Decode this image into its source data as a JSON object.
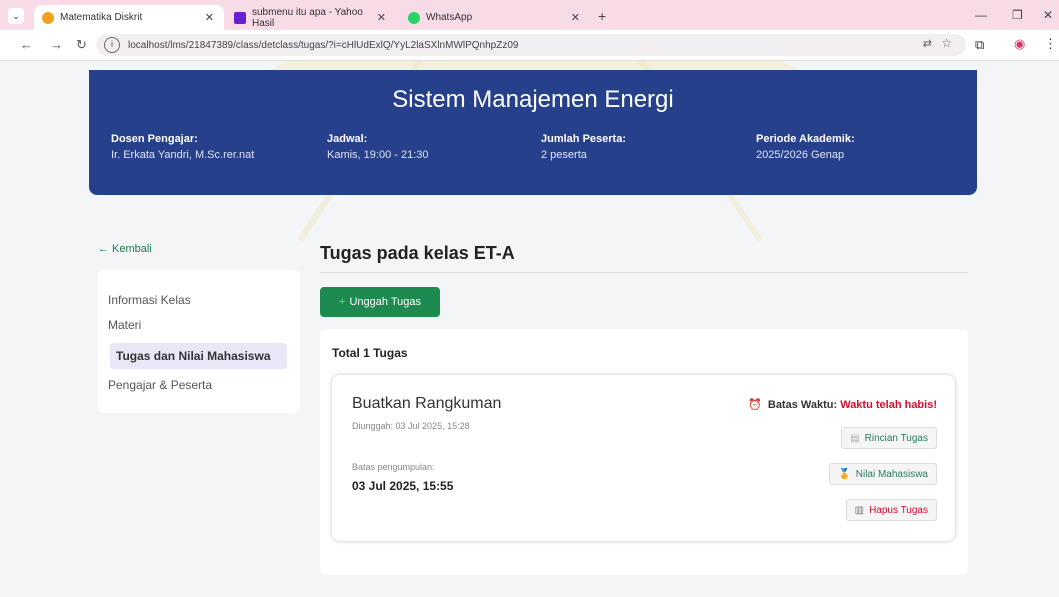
{
  "browser": {
    "tabs": [
      {
        "title": "Matematika Diskrit",
        "color": "#f0a020",
        "active": true
      },
      {
        "title": "submenu itu apa - Yahoo Hasil",
        "color": "#6a1fd1",
        "active": false
      },
      {
        "title": "WhatsApp",
        "color": "#25d366",
        "active": false
      }
    ],
    "url": "localhost/lms/21847389/class/detclass/tugas/?i=cHlUdExlQ/YyL2laSXlnMWlPQnhpZz09"
  },
  "header": {
    "course_title": "Sistem Manajemen Energi",
    "meta": [
      {
        "label": "Dosen Pengajar:",
        "value": "Ir. Erkata Yandri, M.Sc.rer.nat"
      },
      {
        "label": "Jadwal:",
        "value": "Kamis, 19:00 - 21:30"
      },
      {
        "label": "Jumlah Peserta:",
        "value": "2 peserta"
      },
      {
        "label": "Periode Akademik:",
        "value": "2025/2026 Genap"
      }
    ]
  },
  "sidebar": {
    "back_label": "← Kembali",
    "items": [
      {
        "label": "Informasi Kelas"
      },
      {
        "label": "Materi"
      },
      {
        "label": "Tugas dan Nilai Mahasiswa",
        "active": true
      },
      {
        "label": "Pengajar & Peserta"
      }
    ]
  },
  "main": {
    "title": "Tugas pada kelas ET-A",
    "upload_label": "Unggah Tugas",
    "total_label": "Total 1 Tugas",
    "task": {
      "title": "Buatkan Rangkuman",
      "uploaded": "Diunggah: 03 Jul 2025, 15:28",
      "due_label": "Batas pengumpulan:",
      "due_value": "03 Jul 2025, 15:55",
      "deadline_label": "Batas Waktu:",
      "deadline_status": "Waktu telah habis!",
      "buttons": {
        "detail": "Rincian Tugas",
        "grades": "Nilai Mahasiswa",
        "delete": "Hapus Tugas"
      }
    }
  },
  "colors": {
    "hero": "#27408b",
    "primary_green": "#1d8a4f",
    "danger": "#d0102c",
    "tabbar": "#f7dbe7"
  }
}
